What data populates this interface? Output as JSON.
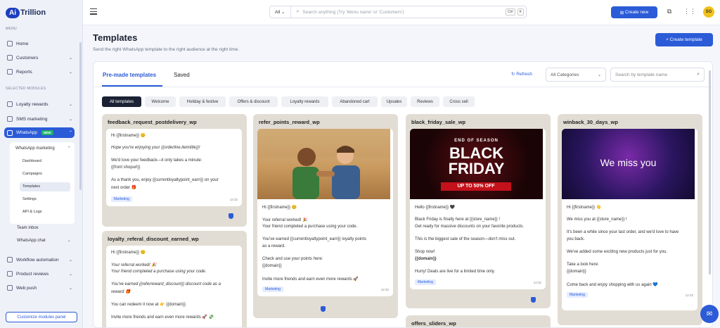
{
  "brand": {
    "logo_ai": "Ai",
    "logo_text": "Trillion"
  },
  "sidebar": {
    "menu_label": "MENU",
    "modules_label": "SELECTED MODULES",
    "items": [
      {
        "label": "Home",
        "icon": "home-icon"
      },
      {
        "label": "Customers",
        "icon": "users-icon"
      },
      {
        "label": "Reports",
        "icon": "chart-icon"
      },
      {
        "label": "Loyalty rewards",
        "icon": "gift-icon"
      },
      {
        "label": "SMS marketing",
        "icon": "sms-icon"
      },
      {
        "label": "WhatsApp",
        "icon": "whatsapp-icon",
        "badge": "NEW"
      },
      {
        "label": "Workflow automation",
        "icon": "workflow-icon"
      },
      {
        "label": "Product reviews",
        "icon": "star-icon"
      },
      {
        "label": "Web push",
        "icon": "bell-icon"
      }
    ],
    "whatsapp_sub": {
      "group_label": "WhatsApp marketing",
      "items": [
        "Dashboard",
        "Campaigns",
        "Templates",
        "Settings",
        "API & Logs"
      ],
      "team_inbox": "Team inbox",
      "whatsapp_chat": "WhatsApp chat"
    },
    "customize_label": "Customize modules panel"
  },
  "topbar": {
    "search_scope": "All",
    "search_placeholder": "Search anything (Try 'Menu name' or 'Customers')",
    "kbd_ctrl": "Ctrl",
    "kbd_k": "K",
    "create_new": "Create new",
    "avatar_initials": "SG"
  },
  "page": {
    "title": "Templates",
    "subtitle": "Send the right WhatsApp template to the right audience at the right time.",
    "create_template": "Create template"
  },
  "tabs": {
    "premade": "Pre-made templates",
    "saved": "Saved"
  },
  "filters": {
    "refresh": "Refresh",
    "category": "All Categories",
    "search_placeholder": "Search by template name"
  },
  "chips": [
    "All templates",
    "Welcome",
    "Holiday & festive",
    "Offers & discount",
    "Loyalty rewards",
    "Abandoned cart",
    "Upsales",
    "Reviews",
    "Cross sell"
  ],
  "cards": [
    {
      "title": "feedback_request_postdelivery_wp",
      "lines": [
        "Hi {{firstname}} 😊",
        "Hope you're enjoying your {{orderline.itemtitle}}!",
        "We'd love your feedback—it only takes a minute:",
        "{{front shopurl}}",
        "As a thank you, enjoy {{currentloyaltypoint_earn}} on your",
        "next order 🎁"
      ],
      "tag": "Marketing",
      "time": "12:32"
    },
    {
      "title": "loyalty_referal_discount_earned_wp",
      "lines": [
        "Hi {{firstname}} 😊",
        "Your referral worked! 🎉",
        "Your friend completed a purchase using your code.",
        "You've earned {{referreward_discount}} discount code as a",
        "reward 🎁",
        "You can redeem it now at 👉 {{domain}}",
        "Invite more friends and earn even more rewards 🚀 💸"
      ]
    },
    {
      "title": "refer_points_reward_wp",
      "lines": [
        "Hi {{firstname}} 😊",
        "Your referral worked! 🎉",
        "Your friend completed a purchase using your code.",
        "You've earned {{currentloyaltypoint_earn}} loyalty points",
        "as a reward.",
        "Check and use your points here:",
        "{{domain}}",
        "Invite more friends and earn even more rewards 🚀"
      ],
      "tag": "Marketing",
      "time": "12:32"
    },
    {
      "title": "black_friday_sale_wp",
      "banner": {
        "top": "END OF SEASON",
        "line1": "BLACK",
        "line2": "FRIDAY",
        "offer": "UP TO 50% OFF"
      },
      "lines": [
        "Hello {{firstname}} 🖤",
        "Black Friday is finally here at {{store_name}} !",
        "Get ready for massive discounts on your favorite products.",
        "This is the biggest sale of the season—don't miss out.",
        "Shop now!",
        "{{domain}}",
        "Hurry! Deals are live for a limited time only."
      ],
      "tag": "Marketing",
      "time": "12:32"
    },
    {
      "title": "offers_sliders_wp"
    },
    {
      "title": "winback_30_days_wp",
      "banner_text": "We miss you",
      "lines": [
        "Hi {{firstname}} 👋",
        "We miss you at {{store_name}} !",
        "It's been a while since your last order, and we'd love to have",
        "you back.",
        "We've added some exciting new products just for you.",
        "Take a look here:",
        "{{domain}}",
        "Come back and enjoy shopping with us again 💙"
      ],
      "tag": "Marketing",
      "time": "12:32"
    }
  ],
  "colors": {
    "primary": "#2b5bd7",
    "card_bg": "#e2ddd4",
    "dark_chip": "#1a2234"
  }
}
